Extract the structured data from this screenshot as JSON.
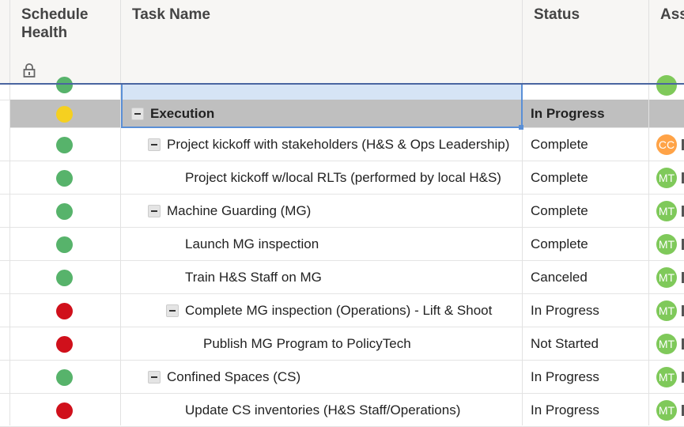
{
  "header": {
    "schedule_health": "Schedule Health",
    "task_name": "Task Name",
    "status": "Status",
    "assigned": "Ass"
  },
  "colors": {
    "green": "#57b36b",
    "red": "#d0101b",
    "yellow": "#f5d020",
    "avatar_green": "#7fc95a",
    "avatar_orange": "#ffa347"
  },
  "rows": [
    {
      "health": "yellow",
      "task": "Execution",
      "status": "In Progress",
      "level": 1,
      "collapse": true,
      "bold": true,
      "avatar": ""
    },
    {
      "health": "green",
      "task": "Project kickoff with stakeholders (H&S & Ops Leadership)",
      "status": "Complete",
      "level": 2,
      "collapse": true,
      "avatar": "CC"
    },
    {
      "health": "green",
      "task": "Project kickoff w/local RLTs (performed by local H&S)",
      "status": "Complete",
      "level": 3,
      "collapse": false,
      "avatar": "MT"
    },
    {
      "health": "green",
      "task": "Machine Guarding (MG)",
      "status": "Complete",
      "level": 2,
      "collapse": true,
      "avatar": "MT"
    },
    {
      "health": "green",
      "task": "Launch MG inspection",
      "status": "Complete",
      "level": 3,
      "collapse": false,
      "avatar": "MT"
    },
    {
      "health": "green",
      "task": "Train H&S Staff on MG",
      "status": "Canceled",
      "level": 3,
      "collapse": false,
      "avatar": "MT"
    },
    {
      "health": "red",
      "task": "Complete MG inspection (Operations) - Lift & Shoot",
      "status": "In Progress",
      "level": 3,
      "collapse": true,
      "avatar": "MT"
    },
    {
      "health": "red",
      "task": "Publish MG Program to PolicyTech",
      "status": "Not Started",
      "level": 4,
      "collapse": false,
      "avatar": "MT"
    },
    {
      "health": "green",
      "task": "Confined Spaces (CS)",
      "status": "In Progress",
      "level": 2,
      "collapse": true,
      "avatar": "MT"
    },
    {
      "health": "red",
      "task": "Update CS inventories (H&S Staff/Operations)",
      "status": "In Progress",
      "level": 3,
      "collapse": false,
      "avatar": "MT"
    }
  ]
}
